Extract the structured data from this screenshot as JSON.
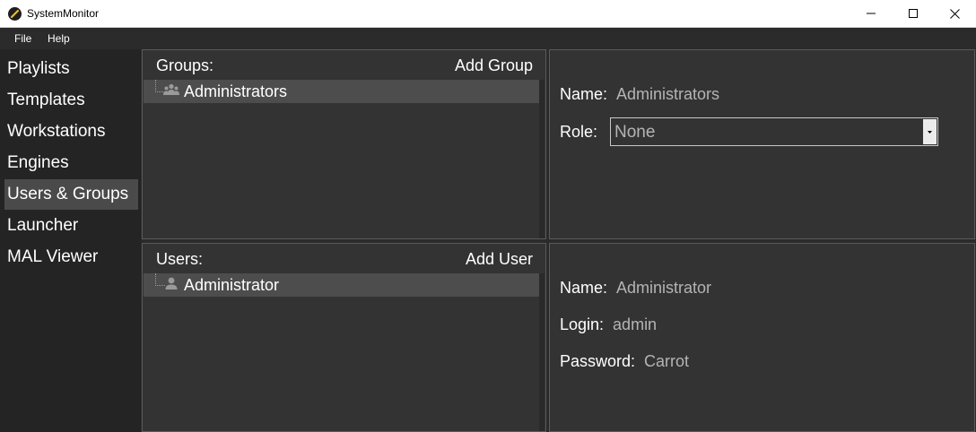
{
  "window": {
    "title": "SystemMonitor"
  },
  "menu": {
    "items": [
      "File",
      "Help"
    ]
  },
  "sidebar": {
    "items": [
      {
        "label": "Playlists",
        "active": false
      },
      {
        "label": "Templates",
        "active": false
      },
      {
        "label": "Workstations",
        "active": false
      },
      {
        "label": "Engines",
        "active": false
      },
      {
        "label": "Users & Groups",
        "active": true
      },
      {
        "label": "Launcher",
        "active": false
      },
      {
        "label": "MAL Viewer",
        "active": false
      }
    ]
  },
  "groups": {
    "header": "Groups:",
    "add_label": "Add Group",
    "items": [
      {
        "label": "Administrators",
        "icon": "group-icon"
      }
    ]
  },
  "group_details": {
    "name_key": "Name:",
    "name_value": "Administrators",
    "role_key": "Role:",
    "role_value": "None"
  },
  "users": {
    "header": "Users:",
    "add_label": "Add User",
    "items": [
      {
        "label": "Administrator",
        "icon": "user-icon"
      }
    ]
  },
  "user_details": {
    "name_key": "Name:",
    "name_value": "Administrator",
    "login_key": "Login:",
    "login_value": "admin",
    "password_key": "Password:",
    "password_value": "Carrot"
  },
  "colors": {
    "background": "#2b2b2b",
    "sidebar": "#242424",
    "panel": "#333333",
    "selected": "#4d4d4d",
    "active_nav": "#4a4a4a",
    "value_text": "#b4b4b4"
  }
}
